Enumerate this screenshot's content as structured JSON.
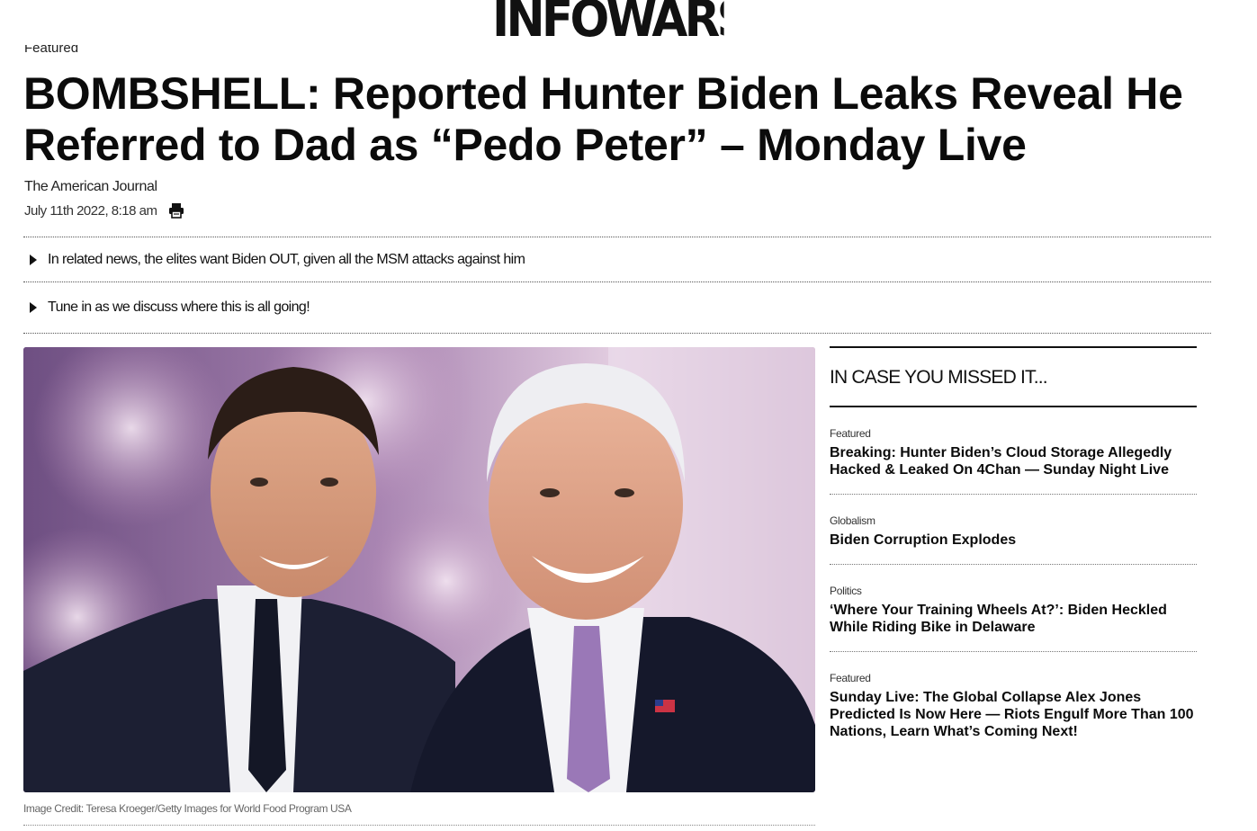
{
  "site": {
    "logo_text": "INFOWARS"
  },
  "article": {
    "category_peek": "Featured",
    "headline": "BOMBSHELL: Reported Hunter Biden Leaks Reveal He Referred to Dad as “Pedo Peter” – Monday Live",
    "author": "The American Journal",
    "date": "July 11th 2022, 8:18 am",
    "print_icon": "print-icon",
    "bullets": [
      "In related news, the elites want Biden OUT, given all the MSM attacks against him",
      "Tune in as we discuss where this is all going!"
    ],
    "image_credit": "Image Credit:  Teresa Kroeger/Getty Images for World Food Program USA"
  },
  "sidebar": {
    "title": "IN CASE YOU MISSED IT...",
    "items": [
      {
        "category": "Featured",
        "headline": "Breaking: Hunter Biden’s Cloud Storage Allegedly Hacked & Leaked On 4Chan — Sunday Night Live"
      },
      {
        "category": "Globalism",
        "headline": "Biden Corruption Explodes"
      },
      {
        "category": "Politics",
        "headline": "‘Where Your Training Wheels At?’: Biden Heckled While Riding Bike in Delaware"
      },
      {
        "category": "Featured",
        "headline": "Sunday Live: The Global Collapse Alex Jones Predicted Is Now Here — Riots Engulf More Than 100 Nations, Learn What’s Coming Next!"
      }
    ]
  }
}
